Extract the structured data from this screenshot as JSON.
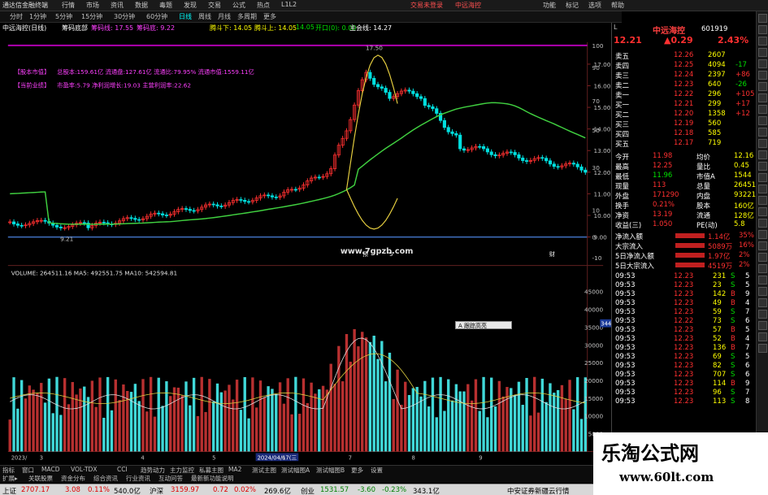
{
  "titlebar": {
    "app_name": "通达信金融终端",
    "links": [
      "行情",
      "市场",
      "资讯",
      "数据",
      "毒题",
      "发现",
      "交易",
      "公式",
      "热点",
      "L1L2"
    ],
    "login": "交易未登录",
    "stock_name": "中远海控",
    "right_items": [
      "功能",
      "标记",
      "选项",
      "帮助"
    ]
  },
  "toolbar": {
    "periods": [
      "分时",
      "1分钟",
      "5分钟",
      "15分钟",
      "30分钟",
      "60分钟",
      "日线",
      "周线",
      "月线",
      "多周期",
      "更多"
    ],
    "active_period": "日线"
  },
  "inforow": {
    "title": "中远海控(日线)",
    "indicator": "筹码底部",
    "lv1_label": "筹码线: 17.55",
    "lv2_label": "筹码底: 9.22",
    "t1": "腾斗下: 14.05",
    "t2": "腾斗上: 14.05",
    "t3": "14.05",
    "t4": "开口(0): 0.00",
    "t5": "主会线: 14.27"
  },
  "chart_text": {
    "info1_label": "【股本市值】",
    "info1_text": "总股本:159.61亿 流通盘:127.61亿 流通比:79.95% 流通市值:1559.11亿",
    "info2_label": "【当前业绩】",
    "info2_text": "市盈率:5.79 净利润增长:19.03 主营利润率:22.62",
    "high_mark": "17.50",
    "low_mark": "9.21",
    "website": "www.7gpzb.com",
    "volume_title": "VOLUME: 264511.16  MA5: 492551.75  MA10: 542594.81",
    "vol_badge": "34498",
    "popup_text": "A 跟踪高亮",
    "date_label": "2024/04/17(三",
    "axis_start": "2023/",
    "month_marks": [
      "3",
      "4",
      "5",
      "6",
      "7",
      "8",
      "9"
    ],
    "top_marks": [
      "预",
      "5",
      "财"
    ]
  },
  "price_axis": [
    "17.00",
    "16.00",
    "15.00",
    "14.00",
    "13.00",
    "12.00",
    "11.00",
    "10.00",
    "9.00"
  ],
  "right_axis": [
    "100",
    "90",
    "70",
    "50",
    "30",
    "10",
    "0",
    "-10"
  ],
  "volume_axis": [
    "45000",
    "40000",
    "35000",
    "30000",
    "25000",
    "20000",
    "15000",
    "10000",
    "5000"
  ],
  "quote": {
    "code_badge": "L",
    "name": "中远海控",
    "code": "601919",
    "price": "12.21",
    "change": "▲0.29",
    "pct": "2.43%",
    "sells": [
      {
        "label": "卖五",
        "price": "12.26",
        "vol": "2607",
        "chg": "",
        "c": "red"
      },
      {
        "label": "卖四",
        "price": "12.25",
        "vol": "4094",
        "chg": "-17",
        "c": "red"
      },
      {
        "label": "卖三",
        "price": "12.24",
        "vol": "2397",
        "chg": "+86",
        "c": "red"
      },
      {
        "label": "卖二",
        "price": "12.23",
        "vol": "640",
        "chg": "-26",
        "c": "red"
      },
      {
        "label": "卖一",
        "price": "12.22",
        "vol": "296",
        "chg": "+105",
        "c": "red"
      }
    ],
    "buys": [
      {
        "label": "买一",
        "price": "12.21",
        "vol": "299",
        "chg": "+17",
        "c": "red"
      },
      {
        "label": "买二",
        "price": "12.20",
        "vol": "1358",
        "chg": "+12",
        "c": "red"
      },
      {
        "label": "买三",
        "price": "12.19",
        "vol": "560",
        "chg": "",
        "c": "red"
      },
      {
        "label": "买四",
        "price": "12.18",
        "vol": "585",
        "chg": "",
        "c": "red"
      },
      {
        "label": "买五",
        "price": "12.17",
        "vol": "719",
        "chg": "",
        "c": "red"
      }
    ],
    "stats": [
      [
        "今开",
        "11.98",
        "均价",
        "12.16"
      ],
      [
        "最高",
        "12.25",
        "量比",
        "0.45"
      ],
      [
        "最低",
        "11.96",
        "市值A",
        "1544"
      ],
      [
        "现量",
        "113",
        "总量",
        "264511"
      ],
      [
        "外盘",
        "171290",
        "内盘",
        "93221"
      ],
      [
        "换手",
        "0.21%",
        "股本",
        "160亿"
      ],
      [
        "净资",
        "13.19",
        "流通",
        "128亿"
      ],
      [
        "收益(三)",
        "1.050",
        "PE(动)",
        "5.8"
      ]
    ],
    "flows": [
      {
        "label": "净流入额",
        "val": "1.14亿",
        "pct": "35%"
      },
      {
        "label": "大宗流入",
        "val": "5089万",
        "pct": "16%"
      },
      {
        "label": "5日净流入额",
        "val": "1.97亿",
        "pct": "2%"
      },
      {
        "label": "5日大宗流入",
        "val": "4519万",
        "pct": "2%"
      }
    ],
    "ticks": [
      [
        "09:53",
        "12.23",
        "231",
        "S",
        "5"
      ],
      [
        "09:53",
        "12.23",
        "23",
        "S",
        "5"
      ],
      [
        "09:53",
        "12.23",
        "142",
        "B",
        "9"
      ],
      [
        "09:53",
        "12.23",
        "49",
        "B",
        "4"
      ],
      [
        "09:53",
        "12.23",
        "59",
        "S",
        "7"
      ],
      [
        "09:53",
        "12.22",
        "73",
        "S",
        "6"
      ],
      [
        "09:53",
        "12.23",
        "57",
        "B",
        "5"
      ],
      [
        "09:53",
        "12.23",
        "52",
        "B",
        "4"
      ],
      [
        "09:53",
        "12.23",
        "136",
        "B",
        "7"
      ],
      [
        "09:53",
        "12.23",
        "69",
        "S",
        "5"
      ],
      [
        "09:53",
        "12.23",
        "82",
        "S",
        "6"
      ],
      [
        "09:53",
        "12.23",
        "707",
        "S",
        "6"
      ],
      [
        "09:53",
        "12.23",
        "114",
        "B",
        "9"
      ],
      [
        "09:53",
        "12.23",
        "96",
        "S",
        "7"
      ],
      [
        "09:53",
        "12.23",
        "113",
        "S",
        "8"
      ]
    ]
  },
  "tabs_row1": [
    "指标",
    "窗口",
    "MACD",
    "VOL-TDX",
    "CCI",
    "趋势动力",
    "主力监控",
    "私募主图",
    "MA2",
    "测试主图",
    "测试幅图A",
    "测试幅图B",
    "更多",
    "设置"
  ],
  "tabs_row2": [
    "扩展▸",
    "关联股票",
    "资金分布",
    "综合资讯",
    "行业资讯",
    "互动问答",
    "最新新功能说明"
  ],
  "status": {
    "sh_label": "上证",
    "sh_val": "2707.17",
    "sh_chg": "3.08",
    "sh_pct": "0.11%",
    "sh_amt": "540.0亿",
    "hs_label": "沪深",
    "hs_val": "3159.97",
    "hs_chg": "0.72",
    "hs_pct": "0.02%",
    "hs_amt": "269.6亿",
    "cy_label": "创业",
    "cy_val": "1531.57",
    "cy_chg": "-3.60",
    "cy_pct": "-0.23%",
    "cy_amt": "343.1亿",
    "broker": "中安证券新疆云行情"
  },
  "watermark": {
    "title": "乐淘公式网",
    "url": "www.60lt.com"
  },
  "colors": {
    "up": "#ff3030",
    "down": "#00ffff",
    "green_line": "#40d040",
    "yellow_line": "#e8d040",
    "ma_white": "#e0e0e0"
  }
}
